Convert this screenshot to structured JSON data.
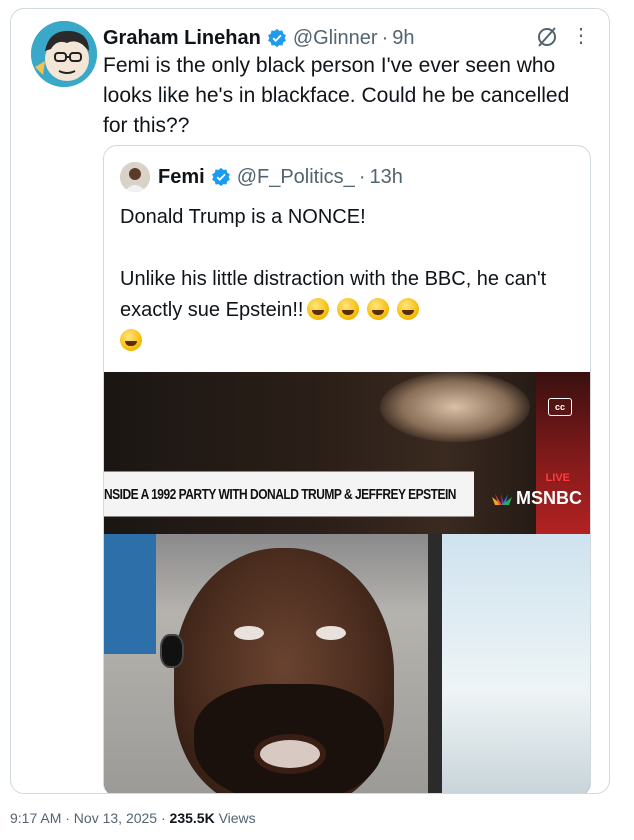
{
  "tweet": {
    "display_name": "Graham Linehan",
    "handle": "@Glinner",
    "time": "9h",
    "text": "Femi is the only black person I've ever seen who looks like he's in blackface. Could he be cancelled for this??"
  },
  "quoted_tweet": {
    "display_name": "Femi",
    "handle": "@F_Politics_",
    "time": "13h",
    "text": "Donald Trump is a NONCE!\n\nUnlike his little distraction with the BBC, he can't exactly sue Epstein!!",
    "emoji_count": 5,
    "media": {
      "chyron": "NSIDE A 1992 PARTY WITH DONALD TRUMP & JEFFREY EPSTEIN",
      "live_label": "LIVE",
      "network": "MSNBC",
      "cc_label": "cc"
    }
  },
  "footer": {
    "timestamp": "9:17 AM · Nov 13, 2025 · ",
    "views_count": "235.5K",
    "views_label": " Views"
  },
  "icons": {
    "verified": "verified-badge-icon",
    "grok": "grok-icon",
    "more": "more-options-icon"
  },
  "colors": {
    "verified_blue": "#1d9bf0",
    "secondary_text": "#536471",
    "border": "#cfd9de"
  }
}
